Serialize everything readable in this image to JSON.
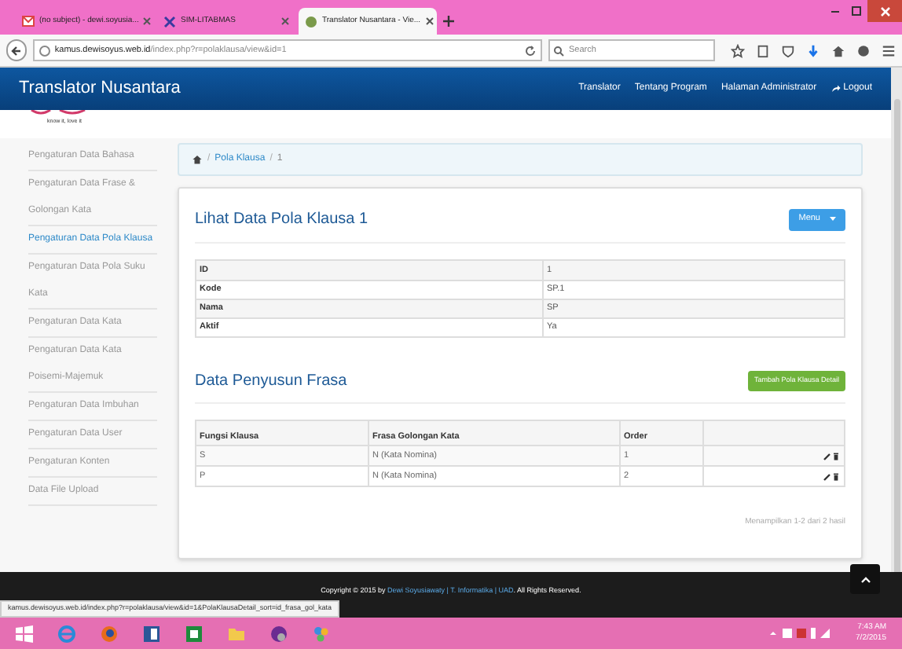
{
  "browser": {
    "tabs": [
      {
        "label": "(no subject) - dewi.soyusia...",
        "selected": false
      },
      {
        "label": "SIM-LITABMAS",
        "selected": false
      },
      {
        "label": "Translator Nusantara - Vie...",
        "selected": true
      }
    ],
    "address_host": "kamus.dewisoyus.web.id",
    "address_path": "/index.php?r=polaklausa/view&id=1",
    "search_placeholder": "Search",
    "status_url": "kamus.dewisoyus.web.id/index.php?r=polaklausa/view&id=1&PolaKlausaDetail_sort=id_frasa_gol_kata"
  },
  "site": {
    "brand": "Translator Nusantara",
    "tagline": "know it, love it",
    "nav": [
      {
        "label": "Translator",
        "kind": "link"
      },
      {
        "label": "Tentang Program",
        "kind": "link"
      },
      {
        "label": "Halaman Administrator",
        "kind": "link"
      },
      {
        "label": "Logout",
        "kind": "logout"
      }
    ]
  },
  "sidebar": {
    "items": [
      {
        "label": "Pengaturan Data Bahasa",
        "selected": false
      },
      {
        "label": "Pengaturan Data Frase & Golongan Kata",
        "selected": false
      },
      {
        "label": "Pengaturan Data Pola Klausa",
        "selected": true
      },
      {
        "label": "Pengaturan Data Pola Suku Kata",
        "selected": false
      },
      {
        "label": "Pengaturan Data Kata",
        "selected": false
      },
      {
        "label": "Pengaturan Data Kata Poisemi-Majemuk",
        "selected": false
      },
      {
        "label": "Pengaturan Data Imbuhan",
        "selected": false
      },
      {
        "label": "Pengaturan Data User",
        "selected": false
      },
      {
        "label": "Pengaturan Konten",
        "selected": false
      },
      {
        "label": "Data File Upload",
        "selected": false
      }
    ]
  },
  "breadcrumb": {
    "separator_1": "/",
    "link": "Pola Klausa",
    "separator_2": "/",
    "current": "1"
  },
  "title": "Lihat Data Pola Klausa 1",
  "menu_button": "Menu",
  "details": [
    {
      "label": "ID",
      "value": "1"
    },
    {
      "label": "Kode",
      "value": "SP.1"
    },
    {
      "label": "Nama",
      "value": "SP"
    },
    {
      "label": "Aktif",
      "value": "Ya"
    }
  ],
  "section_title": "Data Penyusun Frasa",
  "add_button": "Tambah Pola Klausa Detail",
  "table": {
    "columns": [
      "Fungsi Klausa",
      "Frasa Golongan Kata",
      "Order"
    ],
    "rows": [
      [
        "S",
        "N (Kata Nomina)",
        "1"
      ],
      [
        "P",
        "N (Kata Nomina)",
        "2"
      ]
    ]
  },
  "summary": "Menampilkan 1-2 dari 2 hasil",
  "footer": {
    "before": "Copyright © 2015 by",
    "link": "Dewi Soyusiawaty | T. Informatika | UAD",
    "after": ". All Rights Reserved."
  },
  "taskbar": {
    "time": "7:43 AM",
    "date": "7/2/2015"
  }
}
